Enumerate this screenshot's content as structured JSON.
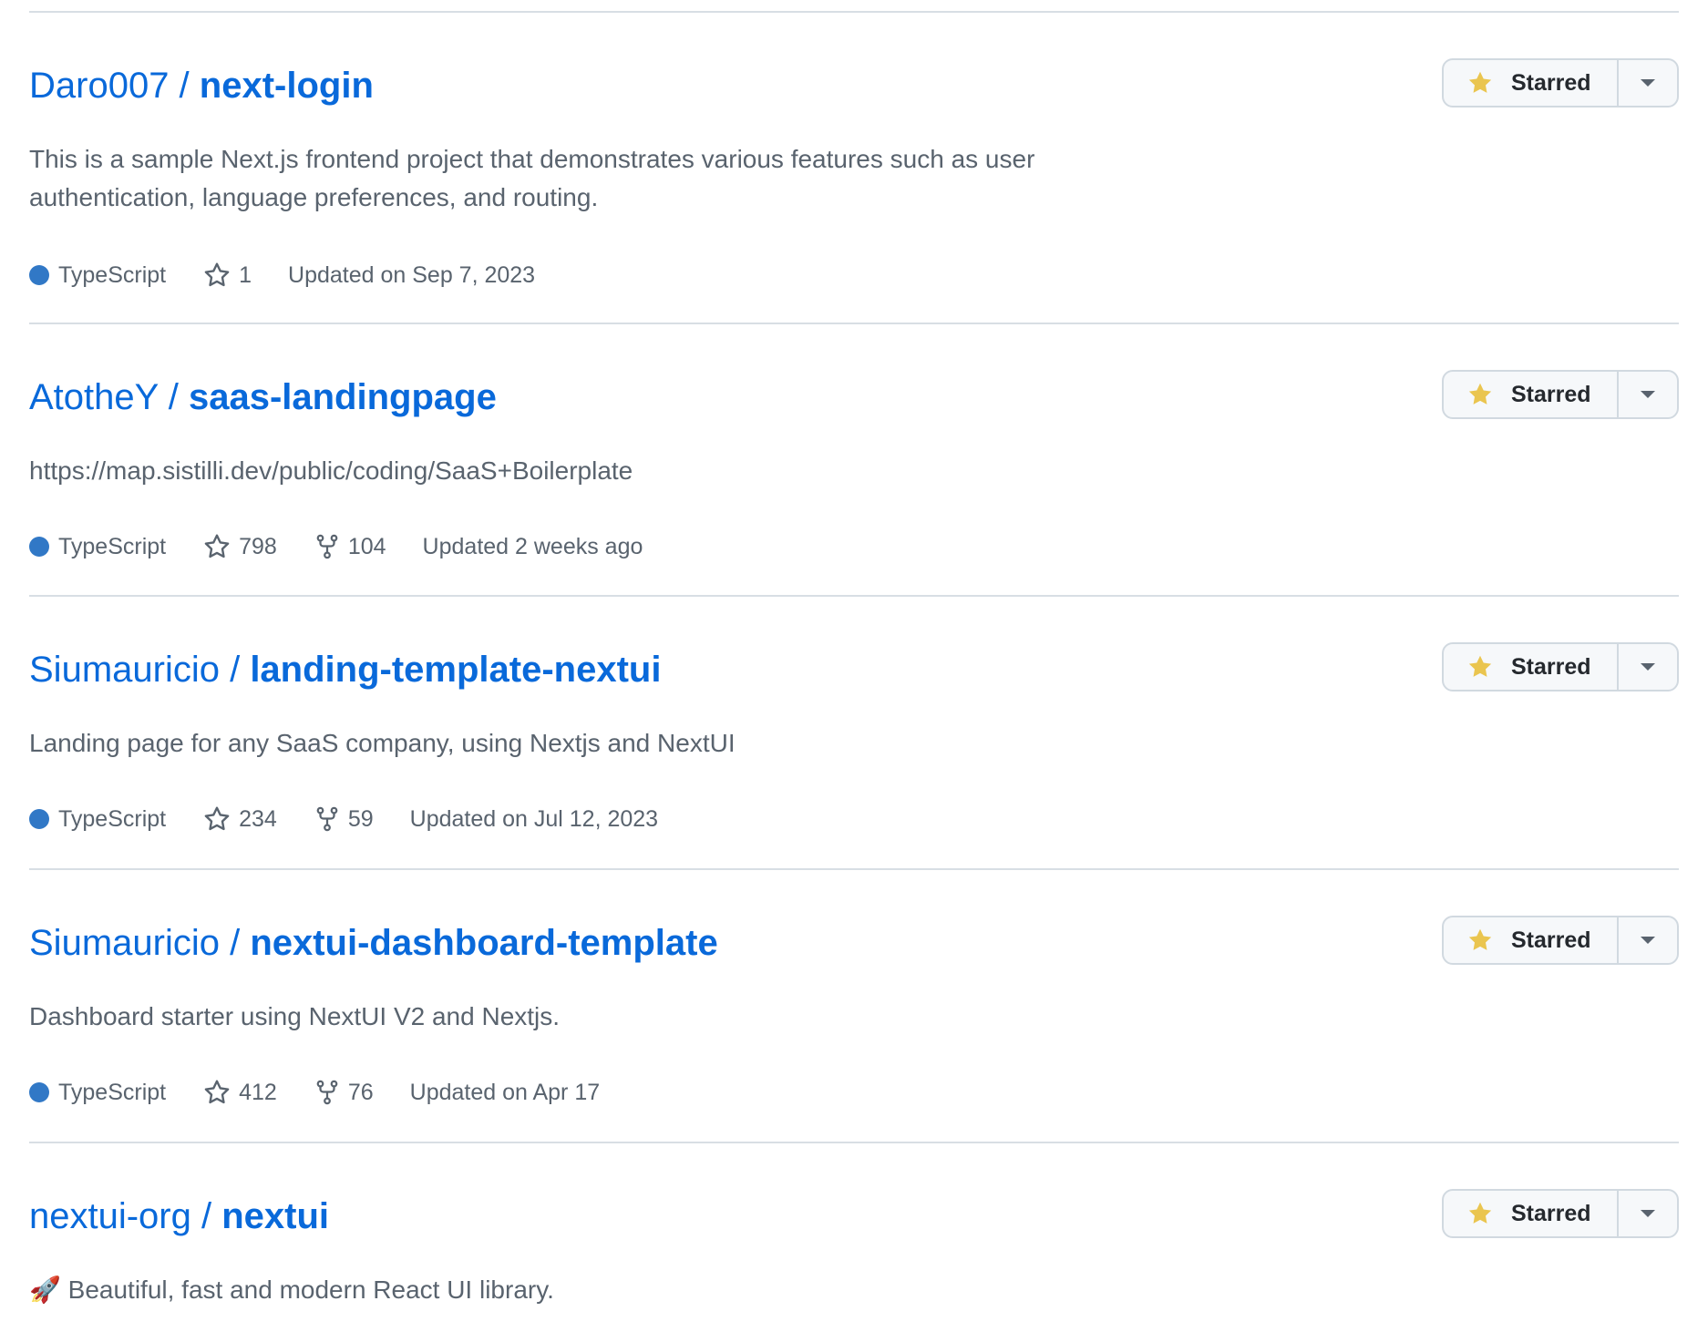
{
  "repos": [
    {
      "owner": "Daro007 / ",
      "name": "next-login",
      "description": "This is a sample Next.js frontend project that demonstrates various features such as user authentication, language preferences, and routing.",
      "language": "TypeScript",
      "stars": "1",
      "forks": "",
      "updated": "Updated on Sep 7, 2023",
      "star_label": "Starred"
    },
    {
      "owner": "AtotheY / ",
      "name": "saas-landingpage",
      "description": "https://map.sistilli.dev/public/coding/SaaS+Boilerplate",
      "language": "TypeScript",
      "stars": "798",
      "forks": "104",
      "updated": "Updated 2 weeks ago",
      "star_label": "Starred"
    },
    {
      "owner": "Siumauricio / ",
      "name": "landing-template-nextui",
      "description": "Landing page for any SaaS company, using Nextjs and NextUI",
      "language": "TypeScript",
      "stars": "234",
      "forks": "59",
      "updated": "Updated on Jul 12, 2023",
      "star_label": "Starred"
    },
    {
      "owner": "Siumauricio / ",
      "name": "nextui-dashboard-template",
      "description": "Dashboard starter using NextUI V2 and Nextjs.",
      "language": "TypeScript",
      "stars": "412",
      "forks": "76",
      "updated": "Updated on Apr 17",
      "star_label": "Starred"
    },
    {
      "owner": "nextui-org / ",
      "name": "nextui",
      "description": "🚀 Beautiful, fast and modern React UI library.",
      "language": "",
      "stars": "",
      "forks": "",
      "updated": "",
      "star_label": "Starred"
    }
  ],
  "colors": {
    "link": "#0969da",
    "typescript": "#3178c6",
    "star_fill": "#eac54f",
    "muted": "#59636e",
    "border": "#d8dee4"
  },
  "icons": {
    "language": "language-dot-icon",
    "stars": "star-outline-icon",
    "forks": "fork-icon",
    "starred": "star-filled-icon",
    "caret": "caret-down-icon"
  }
}
